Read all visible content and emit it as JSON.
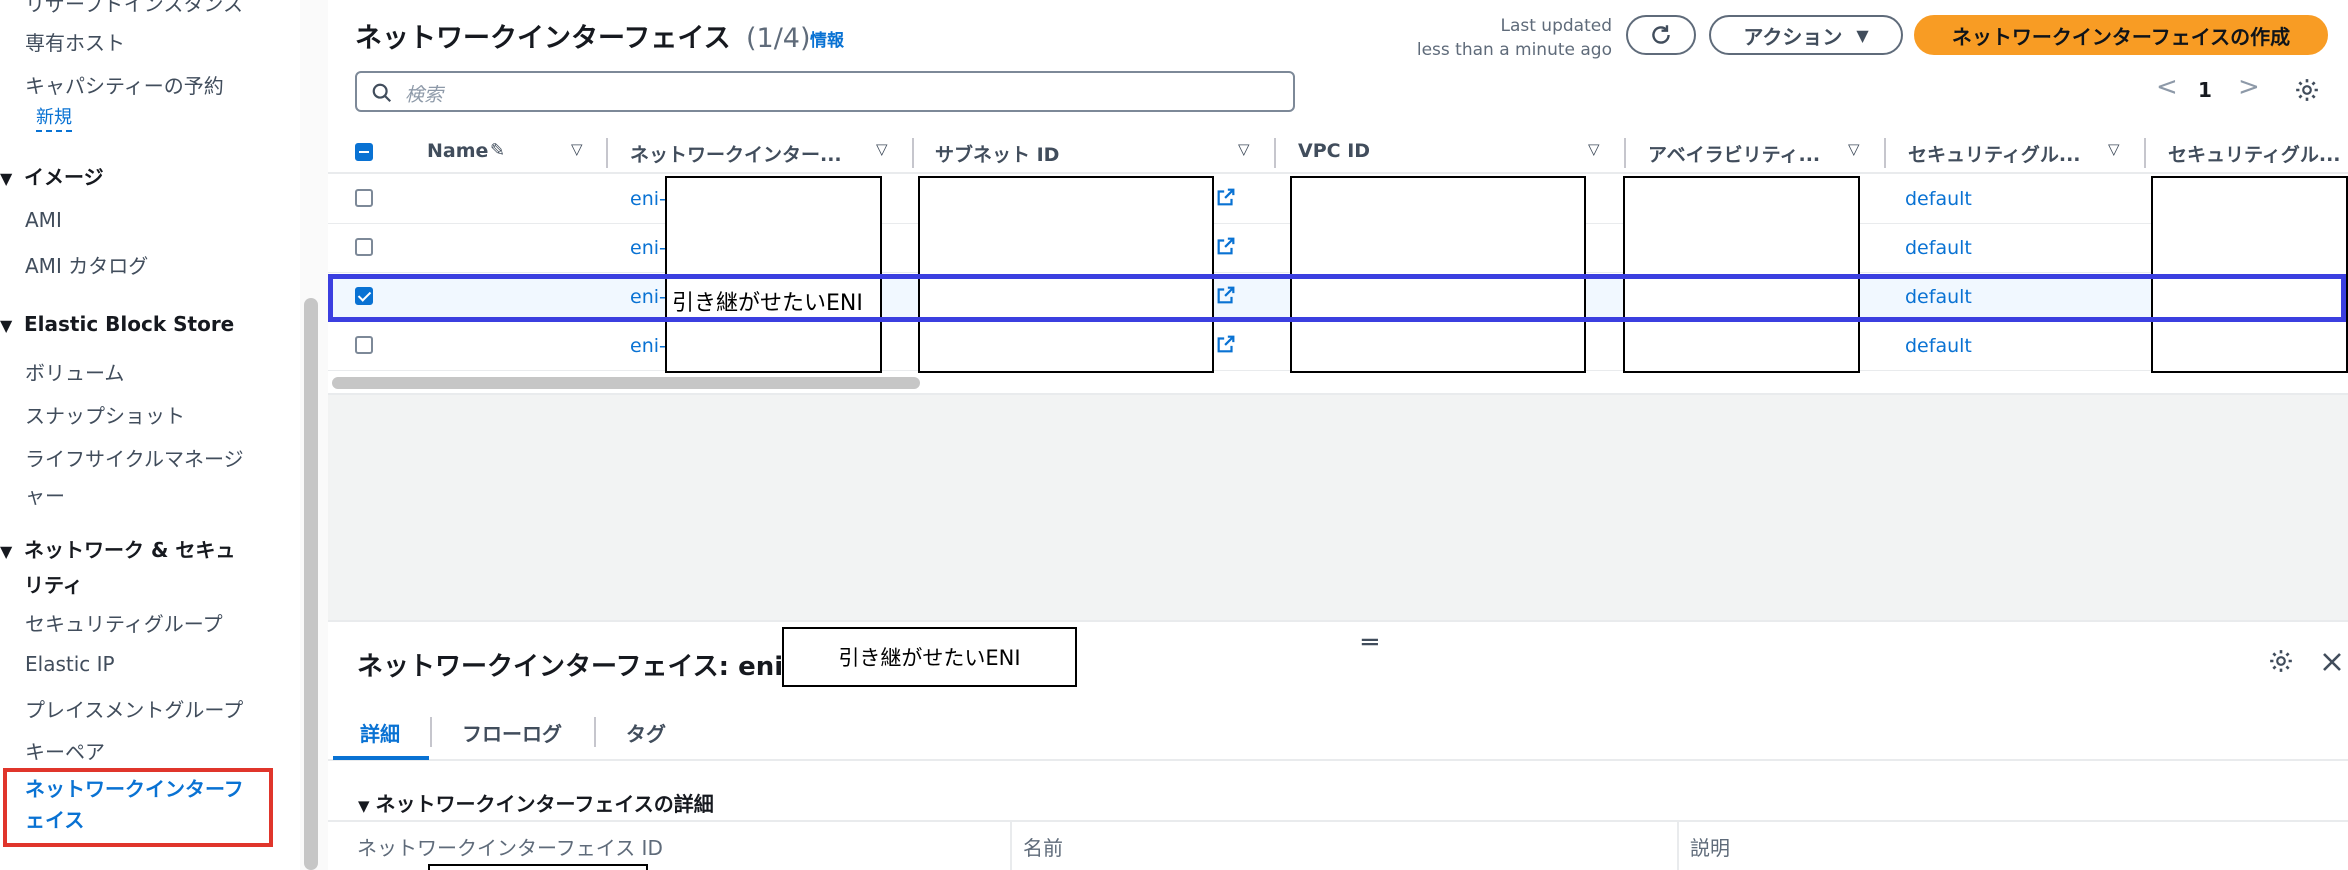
{
  "sidebar": {
    "partial_top_item": "リザーブドインスタンス",
    "items_top": {
      "dedicated_hosts": "専有ホスト",
      "capacity_reservations": "キャパシティーの予約",
      "new_badge": "新規"
    },
    "images": {
      "header": "イメージ",
      "ami": "AMI",
      "ami_catalog": "AMI カタログ"
    },
    "ebs": {
      "header": "Elastic Block Store",
      "volumes": "ボリューム",
      "snapshots": "スナップショット",
      "lifecycle_line1": "ライフサイクルマネージ",
      "lifecycle_line2": "ャー"
    },
    "network": {
      "header_line1": "ネットワーク & セキュ",
      "header_line2": "リティ",
      "security_groups": "セキュリティグループ",
      "elastic_ip": "Elastic IP",
      "placement_groups": "プレイスメントグループ",
      "key_pairs": "キーペア",
      "network_interfaces_line1": "ネットワークインターフ",
      "network_interfaces_line2": "ェイス"
    }
  },
  "header": {
    "title": "ネットワークインターフェイス",
    "count": "(1/4)",
    "info_link": "情報",
    "last_updated_label": "Last updated",
    "last_updated_value": "less than a minute ago",
    "actions_label": "アクション",
    "create_label": "ネットワークインターフェイスの作成"
  },
  "search": {
    "placeholder": "検索"
  },
  "pagination": {
    "page": "1"
  },
  "table": {
    "columns": [
      "Name",
      "ネットワークインター...",
      "サブネット ID",
      "VPC ID",
      "アベイラビリティ...",
      "セキュリティグル...",
      "セキュリティグル..."
    ],
    "rows": [
      {
        "eni": "eni-",
        "security_group": "default",
        "selected": false
      },
      {
        "eni": "eni-",
        "security_group": "default",
        "selected": false
      },
      {
        "eni": "eni-",
        "security_group": "default",
        "selected": true,
        "annotation": "引き継がせたいENI"
      },
      {
        "eni": "eni-",
        "security_group": "default",
        "selected": false
      }
    ]
  },
  "details": {
    "title_prefix": "ネットワークインターフェイス: eni-",
    "annotation": "引き継がせたいENI",
    "tabs": [
      "詳細",
      "フローログ",
      "タグ"
    ],
    "section_title": "ネットワークインターフェイスの詳細",
    "fields": {
      "interface_id": "ネットワークインターフェイス ID",
      "name": "名前",
      "description": "説明"
    }
  },
  "colors": {
    "accent": "#0972d3",
    "primary_button": "#f89c24",
    "sidebar_highlight": "#e0352b",
    "row_highlight": "#3b3fe0"
  }
}
